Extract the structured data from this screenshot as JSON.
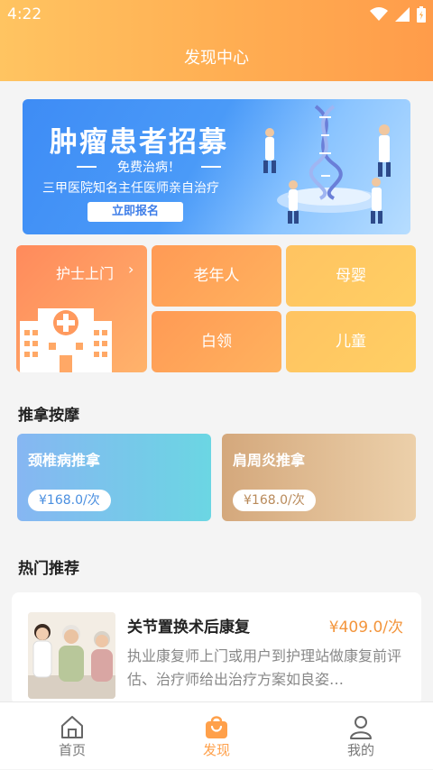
{
  "status": {
    "time": "4:22"
  },
  "header": {
    "title": "发现中心"
  },
  "banner": {
    "title": "肿瘤患者招募",
    "subtitle": "免费治病！",
    "description": "三甲医院知名主任医师亲自治疗",
    "button_label": "立即报名"
  },
  "categories": {
    "featured": {
      "label": "护士上门",
      "arrow": "›"
    },
    "items": [
      {
        "label": "老年人"
      },
      {
        "label": "母婴"
      },
      {
        "label": "白领"
      },
      {
        "label": "儿童"
      }
    ]
  },
  "massage": {
    "section_title": "推拿按摩",
    "items": [
      {
        "name": "颈椎病推拿",
        "price": "¥168.0/次"
      },
      {
        "name": "肩周炎推拿",
        "price": "¥168.0/次"
      }
    ]
  },
  "hot": {
    "section_title": "热门推荐",
    "items": [
      {
        "title": "关节置换术后康复",
        "price": "¥409.0/次",
        "description": "执业康复师上门或用户到护理站做康复前评估、治疗师给出治疗方案如良姿…"
      }
    ]
  },
  "tabbar": {
    "items": [
      {
        "label": "首页",
        "icon": "home-icon",
        "active": false
      },
      {
        "label": "发现",
        "icon": "shopping-bag-icon",
        "active": true
      },
      {
        "label": "我的",
        "icon": "user-icon",
        "active": false
      }
    ]
  },
  "colors": {
    "accent": "#ffa04a",
    "header_start": "#ffc461",
    "header_end": "#ff9c4a",
    "price": "#f3953c"
  }
}
